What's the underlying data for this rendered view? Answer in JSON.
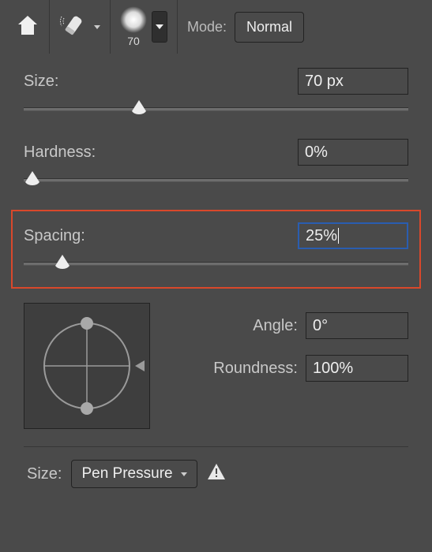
{
  "toolbar": {
    "brush_size_label": "70",
    "mode_label": "Mode:",
    "mode_value": "Normal"
  },
  "settings": {
    "size_label": "Size:",
    "size_value": "70 px",
    "size_slider_percent": 30,
    "hardness_label": "Hardness:",
    "hardness_value": "0%",
    "hardness_slider_percent": 0,
    "spacing_label": "Spacing:",
    "spacing_value": "25%",
    "spacing_slider_percent": 10,
    "angle_label": "Angle:",
    "angle_value": "0°",
    "roundness_label": "Roundness:",
    "roundness_value": "100%"
  },
  "footer": {
    "size_label": "Size:",
    "dynamics_value": "Pen Pressure"
  }
}
